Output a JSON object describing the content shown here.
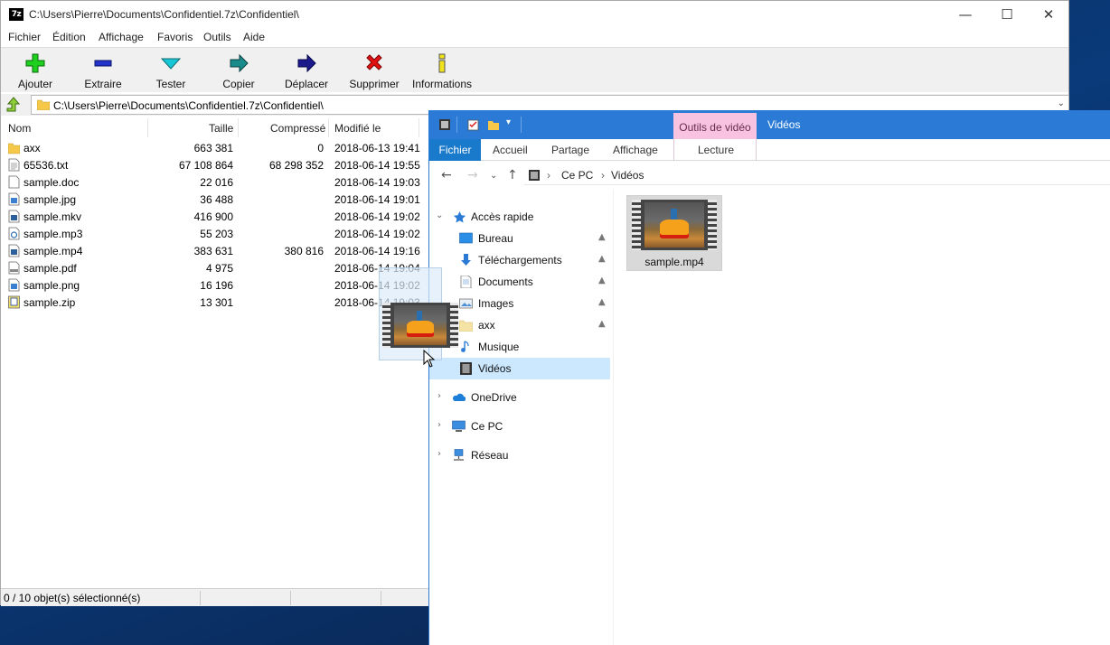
{
  "zip": {
    "title": "C:\\Users\\Pierre\\Documents\\Confidentiel.7z\\Confidentiel\\",
    "app_icon_text": "7z",
    "menu": [
      "Fichier",
      "Édition",
      "Affichage",
      "Favoris",
      "Outils",
      "Aide"
    ],
    "toolbar": [
      "Ajouter",
      "Extraire",
      "Tester",
      "Copier",
      "Déplacer",
      "Supprimer",
      "Informations"
    ],
    "path": "C:\\Users\\Pierre\\Documents\\Confidentiel.7z\\Confidentiel\\",
    "columns": {
      "name": "Nom",
      "size": "Taille",
      "packed": "Compressé",
      "modified": "Modifié le"
    },
    "files": [
      {
        "name": "axx",
        "size": "663 381",
        "packed": "0",
        "modified": "2018-06-13 19:41",
        "type": "folder"
      },
      {
        "name": "65536.txt",
        "size": "67 108 864",
        "packed": "68 298 352",
        "modified": "2018-06-14 19:55",
        "type": "text"
      },
      {
        "name": "sample.doc",
        "size": "22 016",
        "packed": "",
        "modified": "2018-06-14 19:03",
        "type": "doc"
      },
      {
        "name": "sample.jpg",
        "size": "36 488",
        "packed": "",
        "modified": "2018-06-14 19:01",
        "type": "image"
      },
      {
        "name": "sample.mkv",
        "size": "416 900",
        "packed": "",
        "modified": "2018-06-14 19:02",
        "type": "video"
      },
      {
        "name": "sample.mp3",
        "size": "55 203",
        "packed": "",
        "modified": "2018-06-14 19:02",
        "type": "audio"
      },
      {
        "name": "sample.mp4",
        "size": "383 631",
        "packed": "380 816",
        "modified": "2018-06-14 19:16",
        "type": "video"
      },
      {
        "name": "sample.pdf",
        "size": "4 975",
        "packed": "",
        "modified": "2018-06-14 19:04",
        "type": "pdf"
      },
      {
        "name": "sample.png",
        "size": "16 196",
        "packed": "",
        "modified": "2018-06-14 19:02",
        "type": "image"
      },
      {
        "name": "sample.zip",
        "size": "13 301",
        "packed": "",
        "modified": "2018-06-14 19:03",
        "type": "zip"
      }
    ],
    "status": "0 / 10 objet(s) sélectionné(s)"
  },
  "explorer": {
    "context_tab": "Outils de vidéo",
    "title": "Vidéos",
    "ribbon_tabs": [
      "Fichier",
      "Accueil",
      "Partage",
      "Affichage",
      "Lecture"
    ],
    "breadcrumb": [
      "Ce PC",
      "Vidéos"
    ],
    "nav": {
      "quick_access": "Accès rapide",
      "items": [
        "Bureau",
        "Téléchargements",
        "Documents",
        "Images",
        "axx",
        "Musique",
        "Vidéos"
      ],
      "onedrive": "OneDrive",
      "this_pc": "Ce PC",
      "network": "Réseau"
    },
    "file": "sample.mp4"
  },
  "colors": {
    "accent_blue": "#2b7bd6",
    "context_tab_pink": "#f7c3e1",
    "selection": "#cce8ff"
  }
}
